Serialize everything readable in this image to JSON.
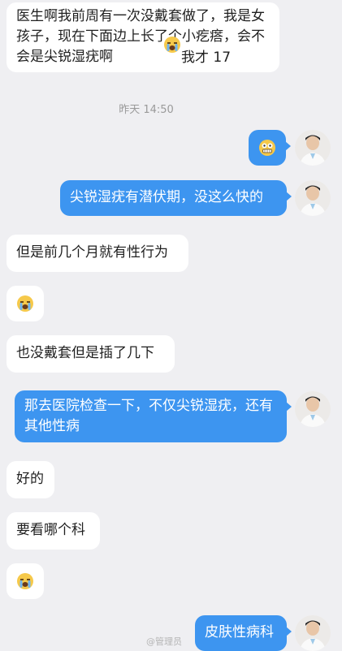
{
  "timestamp": "昨天 14:50",
  "messages": [
    {
      "text": "医生啊我前周有一次没戴套做了，我是女孩子，现在下面边上长了个小疙瘩，会不会是尖锐湿疣啊",
      "suffix": "我才 17",
      "emoji": "crying-face"
    },
    {
      "emoji": "grimacing-face"
    },
    {
      "text": "尖锐湿疣有潜伏期，没这么快的"
    },
    {
      "text": "但是前几个月就有性行为"
    },
    {
      "emoji": "crying-face"
    },
    {
      "text": "也没戴套但是插了几下"
    },
    {
      "text": "那去医院检查一下，不仅尖锐湿疣，还有其他性病"
    },
    {
      "text": "好的"
    },
    {
      "text": "要看哪个科"
    },
    {
      "emoji": "crying-face"
    },
    {
      "text": "皮肤性病科"
    }
  ],
  "watermark": "@管理员"
}
